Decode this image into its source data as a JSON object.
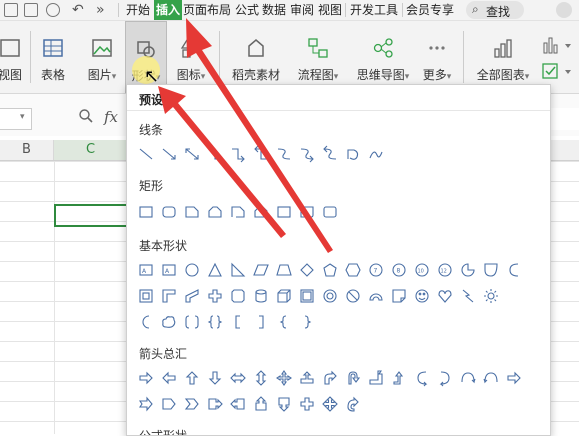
{
  "menu": {
    "tabs": [
      "开始",
      "插入",
      "页面布局",
      "公式",
      "数据",
      "审阅",
      "视图",
      "开发工具",
      "会员专享"
    ],
    "active_tab": "插入",
    "more": "»",
    "search": "查找"
  },
  "ribbon": {
    "items": [
      "视图",
      "表格",
      "图片",
      "形状",
      "图标",
      "稻壳素材",
      "流程图",
      "思维导图",
      "更多",
      "全部图表"
    ],
    "dropdown_mark": "▾"
  },
  "formula": {
    "fx": "fx",
    "zoom_icon": "magnifier-icon"
  },
  "columns": [
    "B",
    "C"
  ],
  "panel": {
    "title": "预设",
    "sections": [
      "线条",
      "矩形",
      "基本形状",
      "箭头总汇",
      "公式形状"
    ]
  },
  "colors": {
    "accent": "#35a24a",
    "active_cell": "#2f8a3e",
    "shape_stroke": "#4a6fa5",
    "annotation_arrow": "#e53935"
  }
}
